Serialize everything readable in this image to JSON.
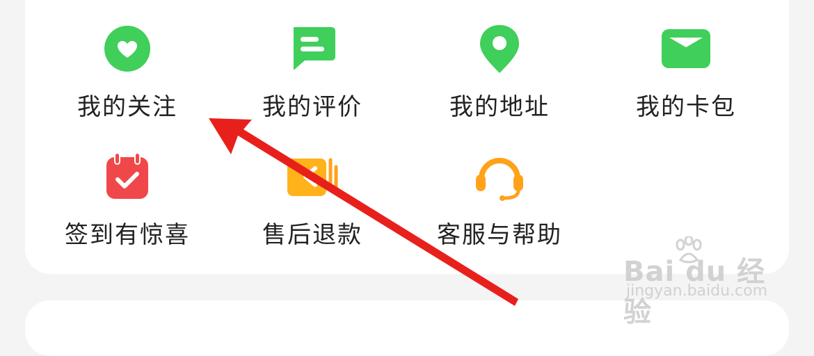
{
  "menu": {
    "items": [
      {
        "label": "我的关注",
        "icon": "heart-icon"
      },
      {
        "label": "我的评价",
        "icon": "comment-icon"
      },
      {
        "label": "我的地址",
        "icon": "location-pin-icon"
      },
      {
        "label": "我的卡包",
        "icon": "card-wallet-icon"
      },
      {
        "label": "签到有惊喜",
        "icon": "calendar-check-icon"
      },
      {
        "label": "售后退款",
        "icon": "refund-icon"
      },
      {
        "label": "客服与帮助",
        "icon": "headset-icon"
      }
    ]
  },
  "watermark": {
    "brand": "Bai du 经验",
    "url": "jingyan.baidu.com"
  },
  "colors": {
    "green": "#3fcf5a",
    "red": "#f0484a",
    "orange": "#ffa21a",
    "arrow": "#e8201c"
  }
}
